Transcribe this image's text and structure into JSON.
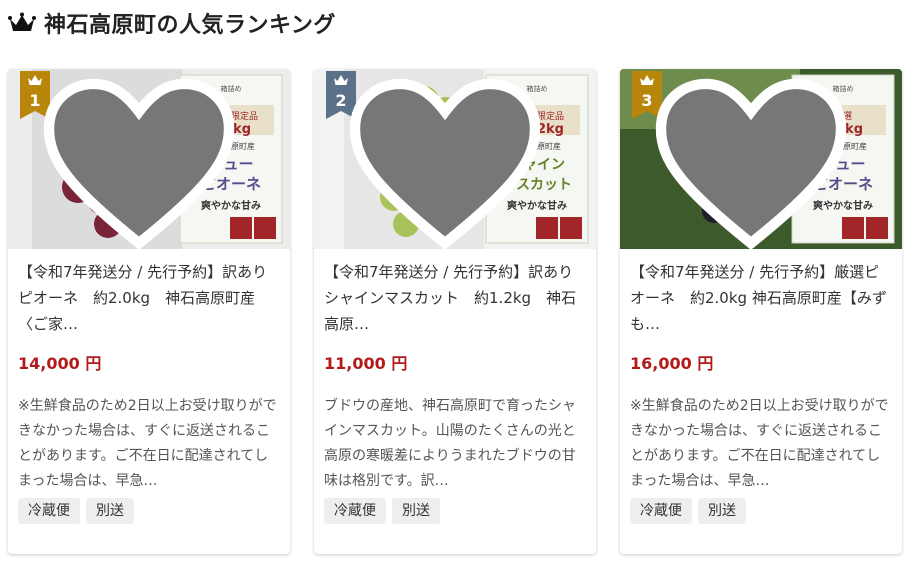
{
  "heading": {
    "icon": "crown-icon",
    "title": "神石高原町の人気ランキング"
  },
  "colors": {
    "gold": "#b8860b",
    "slate": "#5b7089",
    "price": "#b31b1b"
  },
  "products": [
    {
      "rank": "1",
      "rank_color": "#b8860b",
      "title": "【令和7年発送分 / 先行予約】訳ありピオーネ　約2.0kg　神石高原町産〈ご家…",
      "price": "14,000 円",
      "description": "※生鮮食品のため2日以上お受け取りができなかった場合は、すぐに返送されることがあります。ご不在日に配達されてしまった場合は、早急…",
      "tags": [
        "冷蔵便",
        "別送"
      ],
      "label": {
        "line1": "訳あり限定品",
        "weight": "約2kg",
        "origin": "神石高原町産",
        "name1": "ニュー",
        "name2": "ピオーネ",
        "taste": "爽やかな甘み"
      },
      "grape": "purple"
    },
    {
      "rank": "2",
      "rank_color": "#5b7089",
      "title": "【令和7年発送分 / 先行予約】訳ありシャインマスカット　約1.2kg　神石高原…",
      "price": "11,000 円",
      "description": "ブドウの産地、神石高原町で育ったシャインマスカット。山陽のたくさんの光と高原の寒暖差によりうまれたブドウの甘味は格別です。訳…",
      "tags": [
        "冷蔵便",
        "別送"
      ],
      "label": {
        "line1": "訳あり限定品",
        "weight": "約1.2kg",
        "origin": "神石高原町産",
        "name1": "シャイン",
        "name2": "マスカット",
        "taste": "爽やかな甘み"
      },
      "grape": "green"
    },
    {
      "rank": "3",
      "rank_color": "#b8860b",
      "title": "【令和7年発送分 / 先行予約】厳選ピオーネ　約2.0kg 神石高原町産【みずも…",
      "price": "16,000 円",
      "description": "※生鮮食品のため2日以上お受け取りができなかった場合は、すぐに返送されることがあります。ご不在日に配達されてしまった場合は、早急…",
      "tags": [
        "冷蔵便",
        "別送"
      ],
      "label": {
        "line1": "厳選",
        "weight": "約2kg",
        "origin": "神石高原町産",
        "name1": "ニュー",
        "name2": "ピオーネ",
        "taste": "爽やかな甘み"
      },
      "grape": "black"
    }
  ]
}
